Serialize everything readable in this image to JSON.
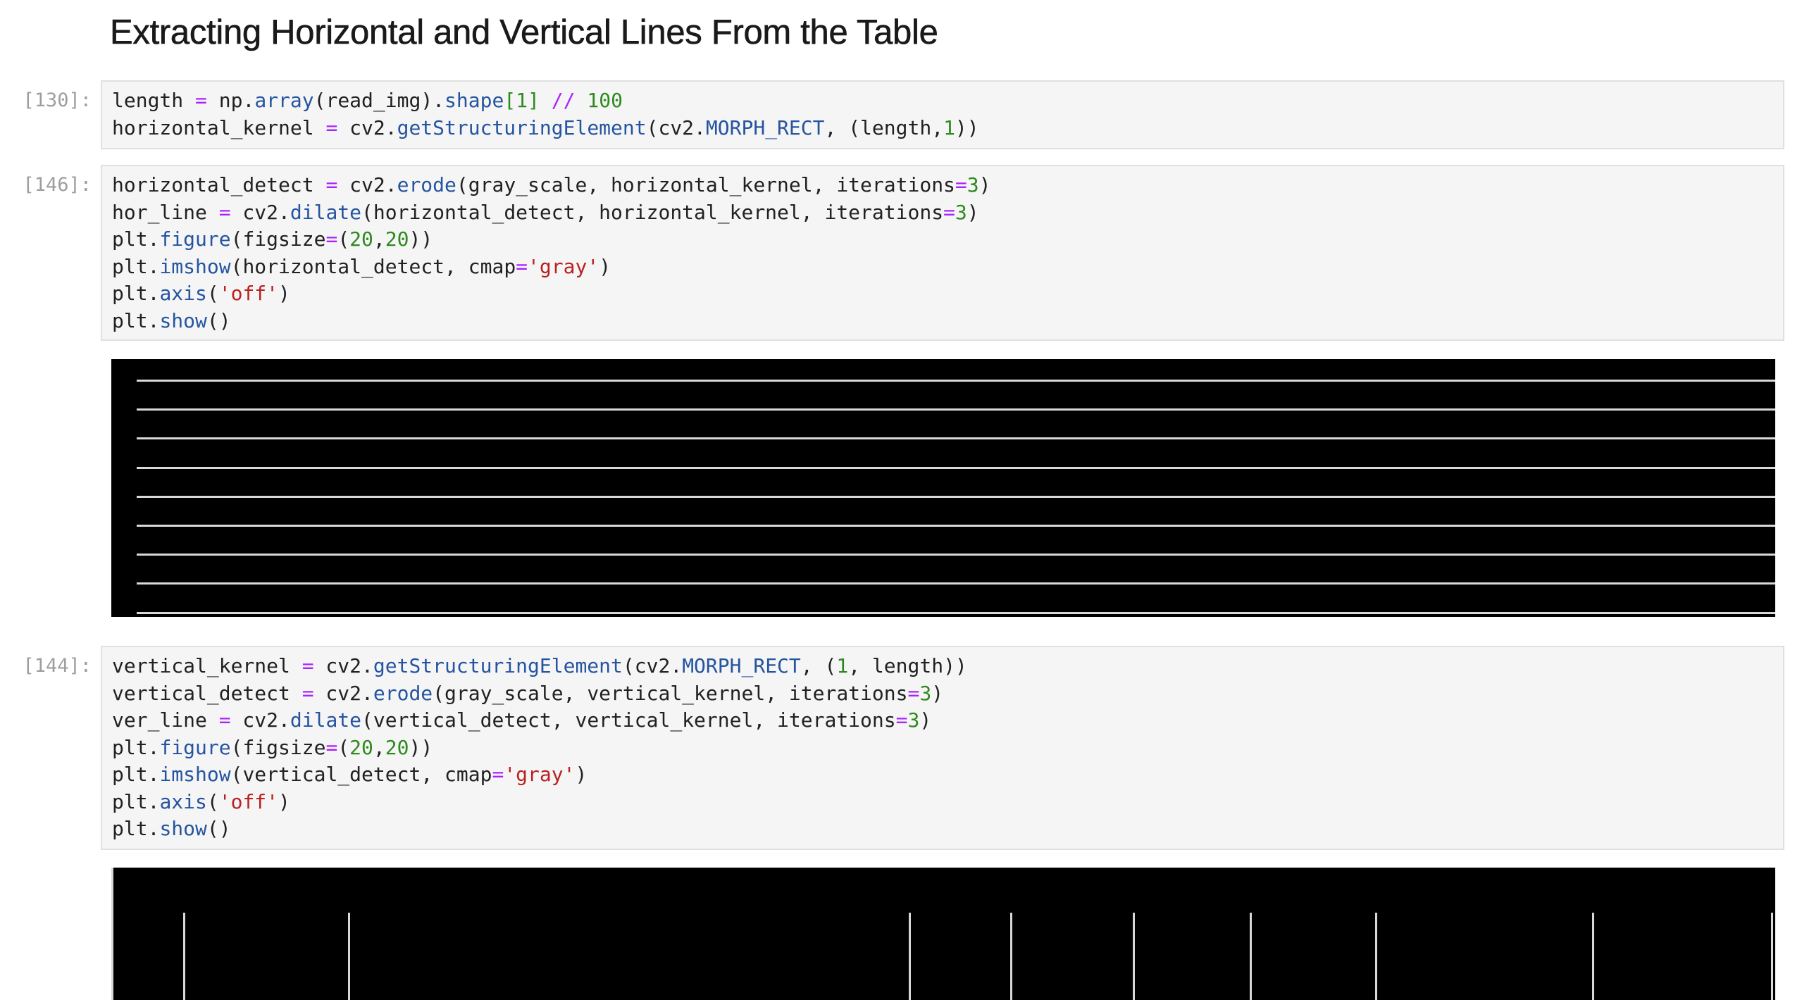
{
  "heading": "Extracting Horizontal and Vertical Lines From the Table",
  "cells": [
    {
      "prompt": "[130]:",
      "lines": [
        [
          [
            "",
            "length "
          ],
          [
            "op",
            "="
          ],
          [
            "",
            " np."
          ],
          [
            "fn",
            "array"
          ],
          [
            "",
            "(read_img)."
          ],
          [
            "fn",
            "shape"
          ],
          [
            "num",
            "[1]"
          ],
          [
            "",
            " "
          ],
          [
            "op",
            "//"
          ],
          [
            "",
            " "
          ],
          [
            "num",
            "100"
          ]
        ],
        [
          [
            "",
            "horizontal_kernel "
          ],
          [
            "op",
            "="
          ],
          [
            "",
            " cv2."
          ],
          [
            "fn",
            "getStructuringElement"
          ],
          [
            "",
            "(cv2."
          ],
          [
            "fn",
            "MORPH_RECT"
          ],
          [
            "",
            ", (length,"
          ],
          [
            "num",
            "1"
          ],
          [
            "",
            "))"
          ]
        ]
      ]
    },
    {
      "prompt": "[146]:",
      "lines": [
        [
          [
            "",
            "horizontal_detect "
          ],
          [
            "op",
            "="
          ],
          [
            "",
            " cv2."
          ],
          [
            "fn",
            "erode"
          ],
          [
            "",
            "(gray_scale, horizontal_kernel, iterations"
          ],
          [
            "op",
            "="
          ],
          [
            "num",
            "3"
          ],
          [
            "",
            ")"
          ]
        ],
        [
          [
            "",
            "hor_line "
          ],
          [
            "op",
            "="
          ],
          [
            "",
            " cv2."
          ],
          [
            "fn",
            "dilate"
          ],
          [
            "",
            "(horizontal_detect, horizontal_kernel, iterations"
          ],
          [
            "op",
            "="
          ],
          [
            "num",
            "3"
          ],
          [
            "",
            ")"
          ]
        ],
        [
          [
            "",
            "plt."
          ],
          [
            "fn",
            "figure"
          ],
          [
            "",
            "(figsize"
          ],
          [
            "op",
            "="
          ],
          [
            "",
            "("
          ],
          [
            "num",
            "20"
          ],
          [
            "",
            ","
          ],
          [
            "num",
            "20"
          ],
          [
            "",
            "))"
          ]
        ],
        [
          [
            "",
            "plt."
          ],
          [
            "fn",
            "imshow"
          ],
          [
            "",
            "(horizontal_detect, cmap"
          ],
          [
            "op",
            "="
          ],
          [
            "str",
            "'gray'"
          ],
          [
            "",
            ")"
          ]
        ],
        [
          [
            "",
            "plt."
          ],
          [
            "fn",
            "axis"
          ],
          [
            "",
            "("
          ],
          [
            "str",
            "'off'"
          ],
          [
            "",
            ")"
          ]
        ],
        [
          [
            "",
            "plt."
          ],
          [
            "fn",
            "show"
          ],
          [
            "",
            "()"
          ]
        ]
      ]
    },
    {
      "prompt": "[144]:",
      "lines": [
        [
          [
            "",
            "vertical_kernel "
          ],
          [
            "op",
            "="
          ],
          [
            "",
            " cv2."
          ],
          [
            "fn",
            "getStructuringElement"
          ],
          [
            "",
            "(cv2."
          ],
          [
            "fn",
            "MORPH_RECT"
          ],
          [
            "",
            ", ("
          ],
          [
            "num",
            "1"
          ],
          [
            "",
            ", length))"
          ]
        ],
        [
          [
            "",
            "vertical_detect "
          ],
          [
            "op",
            "="
          ],
          [
            "",
            " cv2."
          ],
          [
            "fn",
            "erode"
          ],
          [
            "",
            "(gray_scale, vertical_kernel, iterations"
          ],
          [
            "op",
            "="
          ],
          [
            "num",
            "3"
          ],
          [
            "",
            ")"
          ]
        ],
        [
          [
            "",
            "ver_line "
          ],
          [
            "op",
            "="
          ],
          [
            "",
            " cv2."
          ],
          [
            "fn",
            "dilate"
          ],
          [
            "",
            "(vertical_detect, vertical_kernel, iterations"
          ],
          [
            "op",
            "="
          ],
          [
            "num",
            "3"
          ],
          [
            "",
            ")"
          ]
        ],
        [
          [
            "",
            "plt."
          ],
          [
            "fn",
            "figure"
          ],
          [
            "",
            "(figsize"
          ],
          [
            "op",
            "="
          ],
          [
            "",
            "("
          ],
          [
            "num",
            "20"
          ],
          [
            "",
            ","
          ],
          [
            "num",
            "20"
          ],
          [
            "",
            "))"
          ]
        ],
        [
          [
            "",
            "plt."
          ],
          [
            "fn",
            "imshow"
          ],
          [
            "",
            "(vertical_detect, cmap"
          ],
          [
            "op",
            "="
          ],
          [
            "str",
            "'gray'"
          ],
          [
            "",
            ")"
          ]
        ],
        [
          [
            "",
            "plt."
          ],
          [
            "fn",
            "axis"
          ],
          [
            "",
            "("
          ],
          [
            "str",
            "'off'"
          ],
          [
            "",
            ")"
          ]
        ],
        [
          [
            "",
            "plt."
          ],
          [
            "fn",
            "show"
          ],
          [
            "",
            "()"
          ]
        ]
      ]
    }
  ],
  "colors": {
    "operator": "#aa22ff",
    "function": "#2554a0",
    "number": "#2e8a1e",
    "string": "#ba2121",
    "cell_bg": "#f5f5f5",
    "output_bg": "#000000",
    "detected_line": "#d8d8d8"
  }
}
